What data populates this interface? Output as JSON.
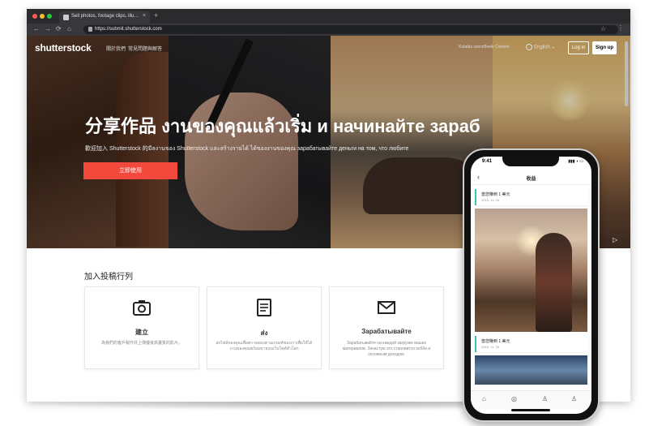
{
  "window": {
    "tab_title": "Sell photos, footage clips, illu…",
    "tab_close": "×",
    "new_tab": "+",
    "url": "https://submit.shutterstock.com"
  },
  "toolbar": {
    "back": "←",
    "forward": "→",
    "reload": "⟳",
    "home": "⌂",
    "star": "☆",
    "menu": "⋮"
  },
  "header": {
    "logo": "shutterstock",
    "nav": [
      "關於我們",
      "常見問題與解答"
    ],
    "contributor_link": "Kutatás szerzőknek Content",
    "language": "English",
    "language_caret": "⌄",
    "login": "Log in",
    "signup": "Sign up"
  },
  "hero": {
    "headline": "分享作品 งานของคุณแล้วเริ่ม и начинайте зараб",
    "subline": "歡迎加入 Shutterstock 的มีลงานของ Shutterstock และสร้างรายได้ ได้ของงานของคุณ зарабатывайте деньги на том, что любите",
    "cta": "立即使用",
    "play_icon": "▷"
  },
  "join": {
    "title": "加入投稿行列",
    "cards": [
      {
        "icon": "camera-icon",
        "title": "建立",
        "desc": "為我們的客戶製作并上傳優良高畫質的影片。"
      },
      {
        "icon": "document-icon",
        "title": "ส่ง",
        "desc": "ส่งไฟล์ของคุณเพื่อตรวจสอบตามเกณฑ์ของเราเพื่อให้ได้งานของคุณพร้อมขายบนเว็บไซต์ทั่วโลก"
      },
      {
        "icon": "envelope-icon",
        "title": "Зарабатывайте",
        "desc": "Зарабатывайте на каждой загрузке ваших материалов. Зачастую это становится хобби и основным доходом."
      }
    ]
  },
  "phone": {
    "status_time": "9:41",
    "status_right": "▮▮▮ ◗ ▭",
    "back": "‹",
    "title": "收益",
    "items": [
      {
        "title": "當您賺到 1 美元",
        "date": "2018. 11. 26"
      },
      {
        "title": "當您賺到 1 美元",
        "date": "2018. 11. 26"
      }
    ],
    "tabs": [
      "⌂",
      "◎",
      "♙",
      "♙"
    ]
  },
  "colors": {
    "accent": "#f2493c",
    "teal": "#3ec1b0",
    "chrome": "#2b2b2e"
  }
}
